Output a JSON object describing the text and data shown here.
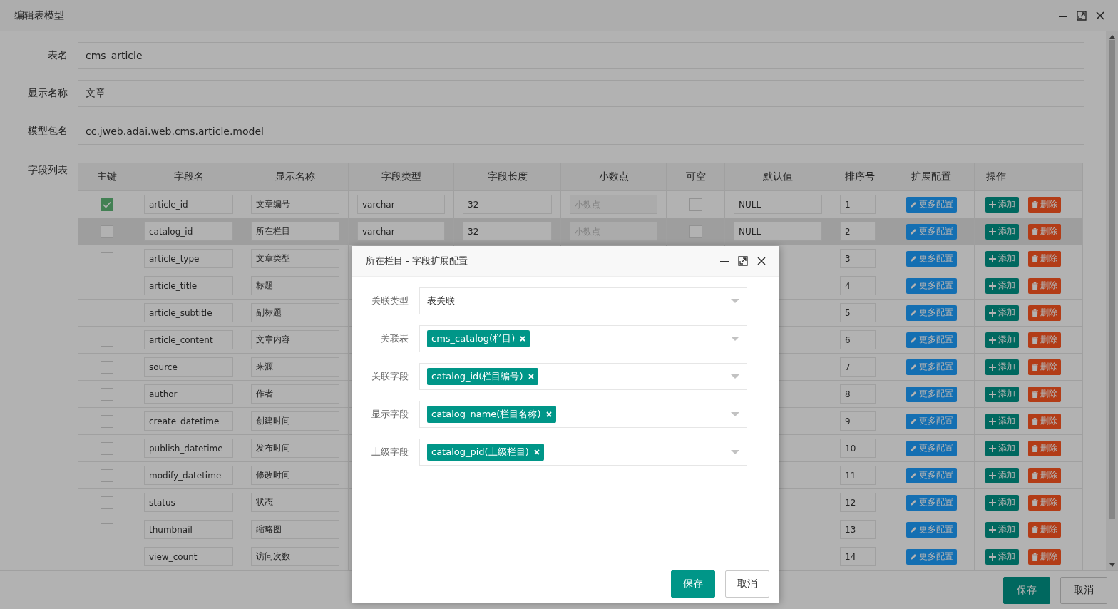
{
  "window": {
    "title": "编辑表模型"
  },
  "form": [
    {
      "label": "表名",
      "value": "cms_article"
    },
    {
      "label": "显示名称",
      "value": "文章"
    },
    {
      "label": "模型包名",
      "value": "cc.jweb.adai.web.cms.article.model"
    }
  ],
  "fields_table": {
    "label": "字段列表",
    "columns": [
      "主键",
      "字段名",
      "显示名称",
      "字段类型",
      "字段长度",
      "小数点",
      "可空",
      "默认值",
      "排序号",
      "扩展配置",
      "操作"
    ],
    "rows": [
      {
        "primary_key": true,
        "name": "article_id",
        "display_name": "文章编号",
        "type": "varchar",
        "length": "32",
        "decimal_placeholder": "小数点",
        "nullable": false,
        "default": "NULL",
        "sort": "1",
        "config_button": "更多配置",
        "add_button": "添加",
        "delete_button": "删除",
        "selected": false
      },
      {
        "primary_key": false,
        "name": "catalog_id",
        "display_name": "所在栏目",
        "type": "varchar",
        "length": "32",
        "decimal_placeholder": "小数点",
        "nullable": false,
        "default": "NULL",
        "sort": "2",
        "config_button": "更多配置",
        "add_button": "添加",
        "delete_button": "删除",
        "selected": true
      },
      {
        "primary_key": false,
        "name": "article_type",
        "display_name": "文章类型",
        "sort": "3",
        "config_button": "更多配置",
        "add_button": "添加",
        "delete_button": "删除",
        "selected": false
      },
      {
        "primary_key": false,
        "name": "article_title",
        "display_name": "标题",
        "sort": "4",
        "config_button": "更多配置",
        "add_button": "添加",
        "delete_button": "删除",
        "selected": false
      },
      {
        "primary_key": false,
        "name": "article_subtitle",
        "display_name": "副标题",
        "sort": "5",
        "config_button": "更多配置",
        "add_button": "添加",
        "delete_button": "删除",
        "selected": false
      },
      {
        "primary_key": false,
        "name": "article_content",
        "display_name": "文章内容",
        "sort": "6",
        "config_button": "更多配置",
        "add_button": "添加",
        "delete_button": "删除",
        "selected": false
      },
      {
        "primary_key": false,
        "name": "source",
        "display_name": "来源",
        "sort": "7",
        "config_button": "更多配置",
        "add_button": "添加",
        "delete_button": "删除",
        "selected": false
      },
      {
        "primary_key": false,
        "name": "author",
        "display_name": "作者",
        "sort": "8",
        "config_button": "更多配置",
        "add_button": "添加",
        "delete_button": "删除",
        "selected": false
      },
      {
        "primary_key": false,
        "name": "create_datetime",
        "display_name": "创建时间",
        "sort": "9",
        "config_button": "更多配置",
        "add_button": "添加",
        "delete_button": "删除",
        "selected": false
      },
      {
        "primary_key": false,
        "name": "publish_datetime",
        "display_name": "发布时间",
        "sort": "10",
        "config_button": "更多配置",
        "add_button": "添加",
        "delete_button": "删除",
        "selected": false
      },
      {
        "primary_key": false,
        "name": "modify_datetime",
        "display_name": "修改时间",
        "sort": "11",
        "config_button": "更多配置",
        "add_button": "添加",
        "delete_button": "删除",
        "selected": false
      },
      {
        "primary_key": false,
        "name": "status",
        "display_name": "状态",
        "sort": "12",
        "config_button": "更多配置",
        "add_button": "添加",
        "delete_button": "删除",
        "selected": false
      },
      {
        "primary_key": false,
        "name": "thumbnail",
        "display_name": "缩略图",
        "sort": "13",
        "config_button": "更多配置",
        "add_button": "添加",
        "delete_button": "删除",
        "selected": false
      },
      {
        "primary_key": false,
        "name": "view_count",
        "display_name": "访问次数",
        "sort": "14",
        "config_button": "更多配置",
        "add_button": "添加",
        "delete_button": "删除",
        "selected": false
      }
    ]
  },
  "footer": {
    "buttons": [
      {
        "label": "保存",
        "kind": "primary"
      },
      {
        "label": "取消",
        "kind": "default"
      }
    ]
  },
  "dialog": {
    "title": "所在栏目 - 字段扩展配置",
    "fields": [
      {
        "label": "关联类型",
        "kind": "text",
        "value": "表关联"
      },
      {
        "label": "关联表",
        "kind": "tags",
        "tags": [
          "cms_catalog(栏目)"
        ]
      },
      {
        "label": "关联字段",
        "kind": "tags",
        "tags": [
          "catalog_id(栏目编号)"
        ]
      },
      {
        "label": "显示字段",
        "kind": "tags",
        "tags": [
          "catalog_name(栏目名称)"
        ]
      },
      {
        "label": "上级字段",
        "kind": "tags",
        "tags": [
          "catalog_pid(上级栏目)"
        ]
      }
    ],
    "buttons": [
      {
        "label": "保存",
        "kind": "primary"
      },
      {
        "label": "取消",
        "kind": "default"
      }
    ]
  }
}
